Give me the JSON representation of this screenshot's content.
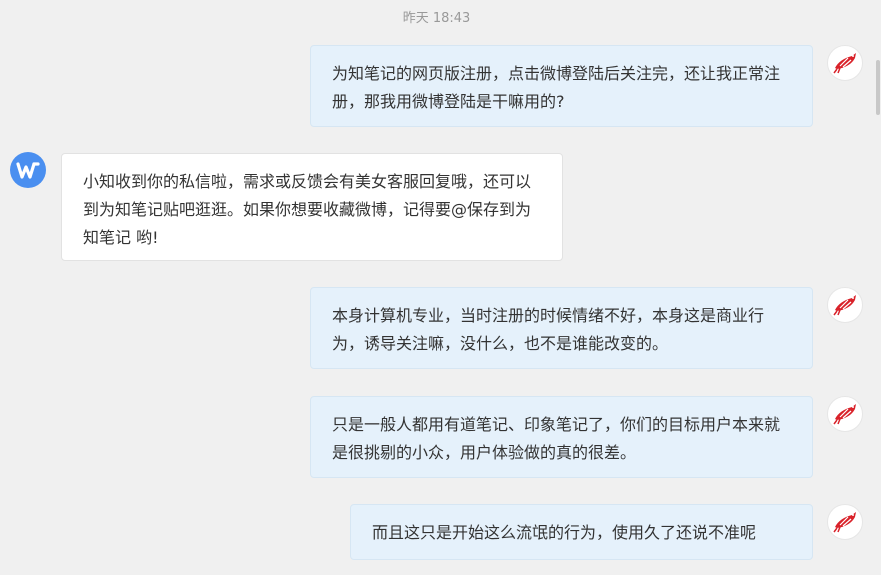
{
  "timestamp": "昨天 18:43",
  "messages": [
    {
      "sender": "user",
      "text": "为知笔记的网页版注册，点击微博登陆后关注完，还让我正常注册，那我用微博登陆是干嘛用的?"
    },
    {
      "sender": "bot",
      "text": "小知收到你的私信啦，需求或反馈会有美女客服回复哦，还可以到为知笔记贴吧逛逛。如果你想要收藏微博，记得要@保存到为知笔记 哟!"
    },
    {
      "sender": "user",
      "text": "本身计算机专业，当时注册的时候情绪不好，本身这是商业行为，诱导关注嘛，没什么，也不是谁能改变的。"
    },
    {
      "sender": "user",
      "text": "只是一般人都用有道笔记、印象笔记了，你们的目标用户本来就是很挑剔的小众，用户体验做的真的很差。"
    },
    {
      "sender": "user",
      "text": "而且这只是开始这么流氓的行为，使用久了还说不准呢"
    }
  ],
  "icons": {
    "user_avatar": "red-bird-avatar-icon",
    "bot_avatar": "wiz-logo-icon"
  },
  "colors": {
    "background": "#f0f0f0",
    "outgoing_bubble": "#e5f1fb",
    "incoming_bubble": "#ffffff",
    "bot_avatar": "#4a8ff0",
    "user_avatar_bird": "#d9222a"
  }
}
